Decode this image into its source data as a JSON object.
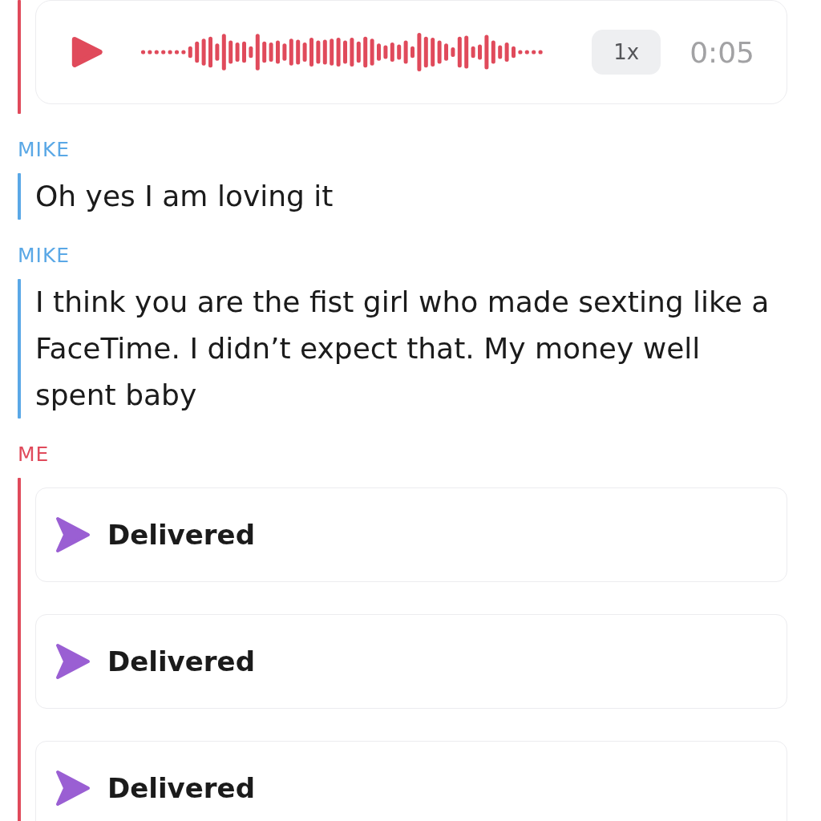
{
  "groups": [
    {
      "color": "#e04a5b",
      "items": [
        {
          "kind": "voice",
          "speed": "1x",
          "duration": "0:05"
        }
      ]
    },
    {
      "sender": "MIKE",
      "color": "#5aa8e6",
      "items": [
        {
          "kind": "text",
          "text": "Oh yes I am loving it"
        }
      ]
    },
    {
      "sender": "MIKE",
      "color": "#5aa8e6",
      "items": [
        {
          "kind": "text",
          "text": "I think you are the fist girl who made sexting like a FaceTime. I didn’t expect that. My money well spent baby"
        }
      ]
    },
    {
      "sender": "ME",
      "color": "#e04a5b",
      "items": [
        {
          "kind": "status",
          "text": "Delivered"
        },
        {
          "kind": "status",
          "text": "Delivered"
        },
        {
          "kind": "status",
          "text": "Delivered"
        }
      ]
    }
  ]
}
